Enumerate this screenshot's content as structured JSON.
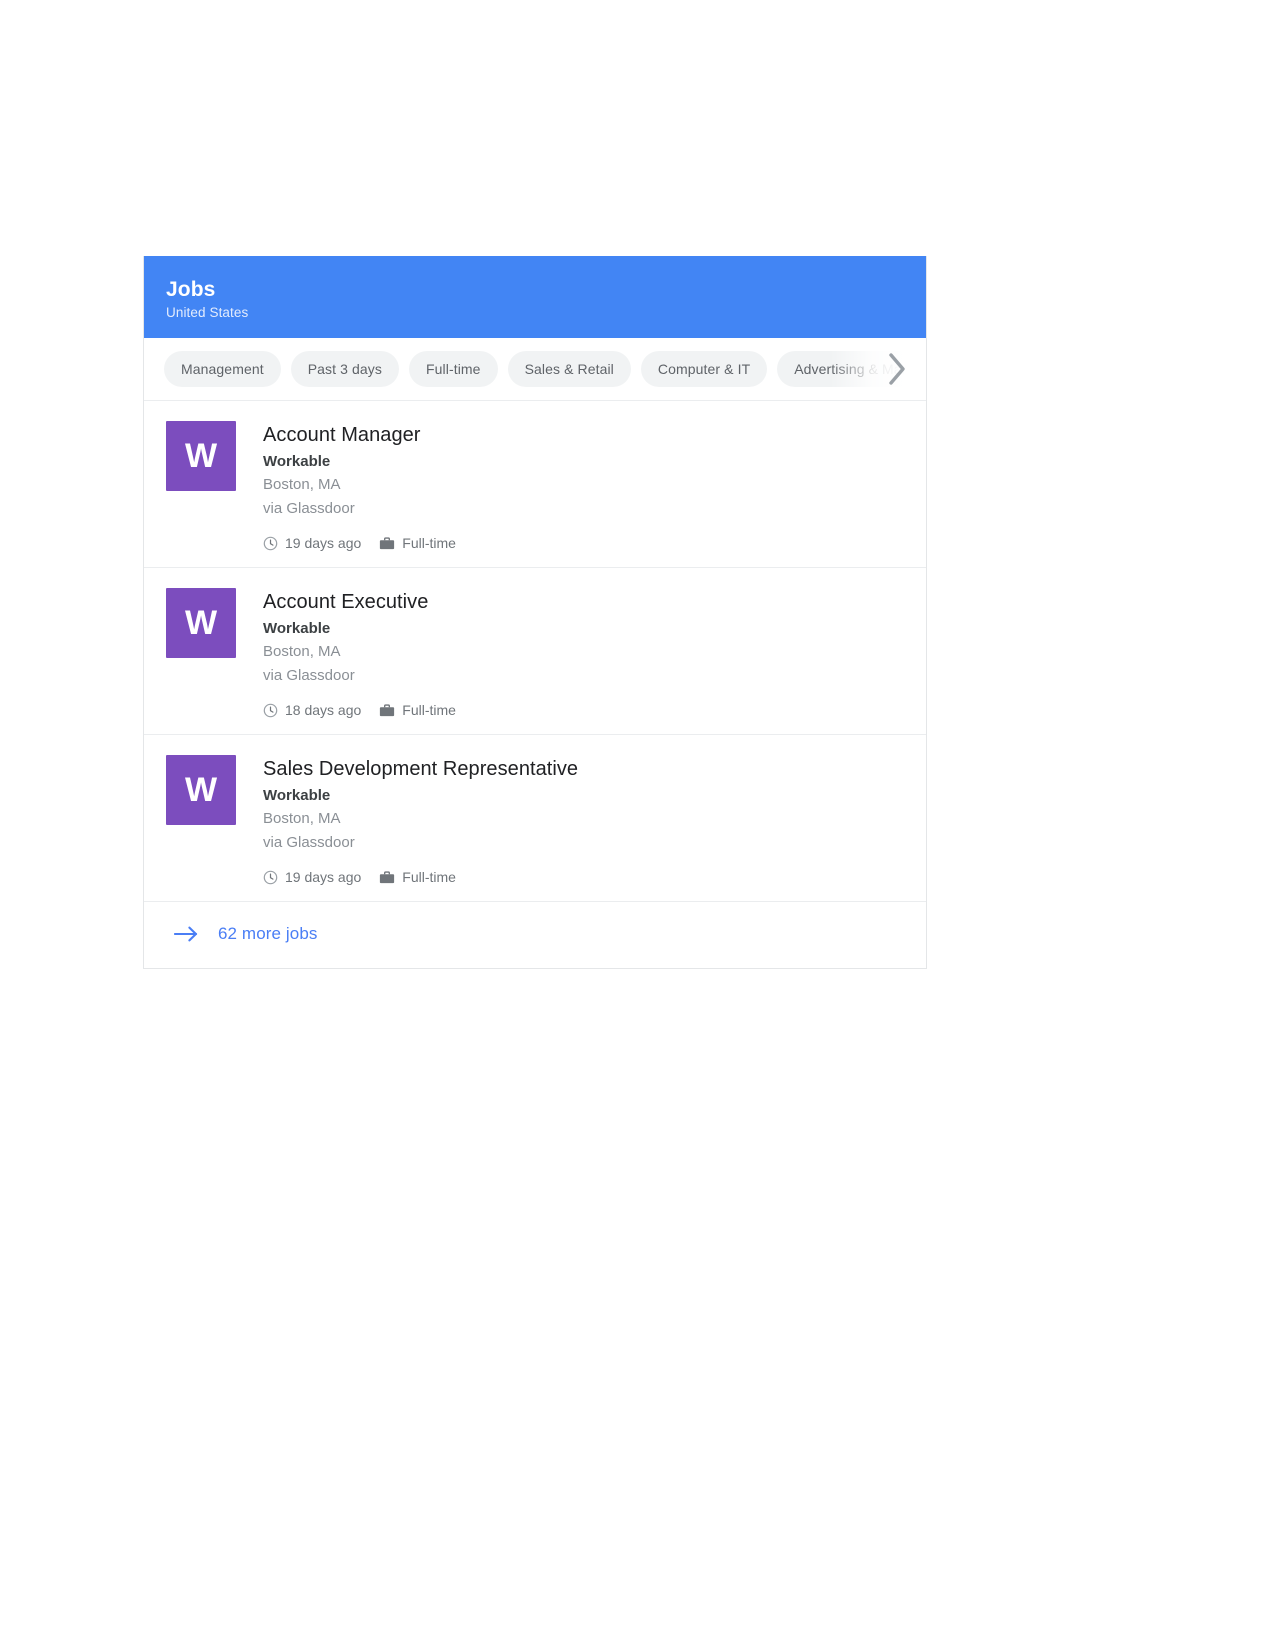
{
  "header": {
    "title": "Jobs",
    "subtitle": "United States",
    "background_color": "#4285f4"
  },
  "filters": {
    "chips": [
      {
        "label": "Management"
      },
      {
        "label": "Past 3 days"
      },
      {
        "label": "Full-time"
      },
      {
        "label": "Sales & Retail"
      },
      {
        "label": "Computer & IT"
      },
      {
        "label": "Advertising & Marketing"
      }
    ],
    "next_icon": "chevron-right-icon"
  },
  "jobs": [
    {
      "logo_letter": "W",
      "logo_color": "#7c4dbe",
      "title": "Account Manager",
      "company": "Workable",
      "location": "Boston, MA",
      "source": "via Glassdoor",
      "posted": "19 days ago",
      "employment_type": "Full-time"
    },
    {
      "logo_letter": "W",
      "logo_color": "#7c4dbe",
      "title": "Account Executive",
      "company": "Workable",
      "location": "Boston, MA",
      "source": "via Glassdoor",
      "posted": "18 days ago",
      "employment_type": "Full-time"
    },
    {
      "logo_letter": "W",
      "logo_color": "#7c4dbe",
      "title": "Sales Development Representative",
      "company": "Workable",
      "location": "Boston, MA",
      "source": "via Glassdoor",
      "posted": "19 days ago",
      "employment_type": "Full-time"
    }
  ],
  "footer": {
    "arrow_icon": "arrow-right-icon",
    "label": "62 more jobs",
    "link_color": "#4a7ef5"
  }
}
